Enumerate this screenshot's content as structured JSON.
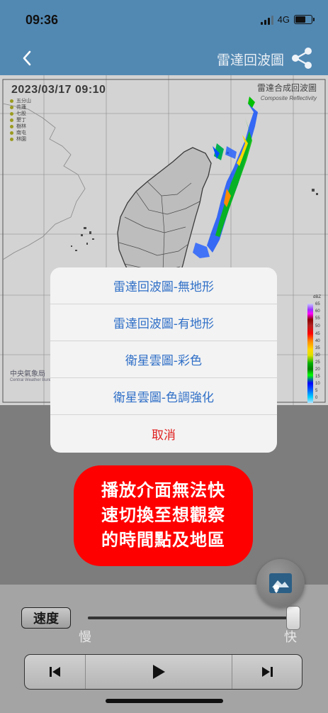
{
  "status": {
    "time": "09:36",
    "network": "4G"
  },
  "nav": {
    "title": "雷達回波圖",
    "back_icon": "chevron-left-icon",
    "share_icon": "share-icon"
  },
  "map": {
    "timestamp": "2023/03/17  09:10",
    "title": "雷達合成回波圖",
    "subtitle": "Composite Reflectivity",
    "logo_text": "中央氣象局",
    "logo_subtext": "Central Weather Bureau",
    "stations": [
      "五分山",
      "花蓮",
      "七股",
      "墾丁",
      "樹林",
      "南屯",
      "林園"
    ],
    "legend_unit": "dBZ",
    "legend_ticks": [
      "65",
      "60",
      "55",
      "50",
      "45",
      "40",
      "35",
      "30",
      "25",
      "20",
      "15",
      "10",
      "5",
      "0"
    ]
  },
  "action_sheet": {
    "items": [
      {
        "label": "雷達回波圖-無地形"
      },
      {
        "label": "雷達回波圖-有地形"
      },
      {
        "label": "衛星雲圖-彩色"
      },
      {
        "label": "衛星雲圖-色調強化"
      }
    ],
    "cancel_label": "取消"
  },
  "annotation": {
    "line1": "播放介面無法快",
    "line2": "速切換至想觀察",
    "line3": "的時間點及地區"
  },
  "controls": {
    "speed_label": "速度",
    "slow_label": "慢",
    "fast_label": "快",
    "speed_value": 1.0
  },
  "colors": {
    "header": "#5289b3",
    "accent_text": "#2f6fc7",
    "cancel_text": "#e02020",
    "annotation_bg": "#ff0000"
  }
}
